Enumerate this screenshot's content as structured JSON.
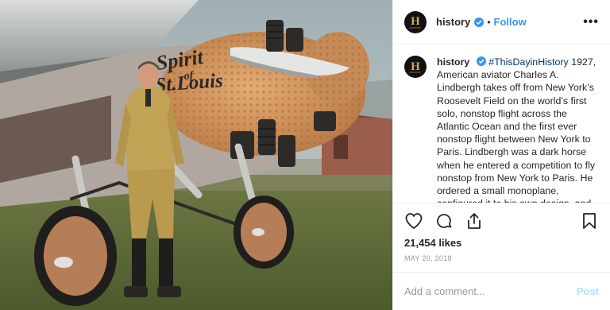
{
  "header": {
    "avatar_letter": "H",
    "avatar_sub": "HISTORY",
    "username": "history",
    "dot": "•",
    "follow_label": "Follow",
    "more_label": "•••"
  },
  "caption": {
    "username": "history",
    "hashtag": "#ThisDayinHistory",
    "text": " 1927, American aviator Charles A. Lindbergh takes off from New York’s Roosevelt Field on the world’s first solo, nonstop flight across the Atlantic Ocean and the first ever nonstop flight between New York to Paris. Lindbergh was a dark horse when he entered a competition to fly nonstop from New York to Paris. He ordered a small monoplane, configured it to his own design, and christened it the Spirit of St. Louis in tribute to his sponsor–the"
  },
  "photo": {
    "nose_text_1": "Spirit",
    "nose_text_2": "of",
    "nose_text_3": "St.Louis"
  },
  "icons": {
    "like": "heart-icon",
    "comment": "comment-icon",
    "share": "share-icon",
    "save": "bookmark-icon"
  },
  "likes": "21,454 likes",
  "date": "MAY 20, 2018",
  "add_comment": {
    "placeholder": "Add a comment...",
    "post_label": "Post"
  },
  "colors": {
    "follow": "#3897f0",
    "post_disabled": "#b2dffc",
    "hashtag": "#003569",
    "verified": "#3897f0"
  }
}
